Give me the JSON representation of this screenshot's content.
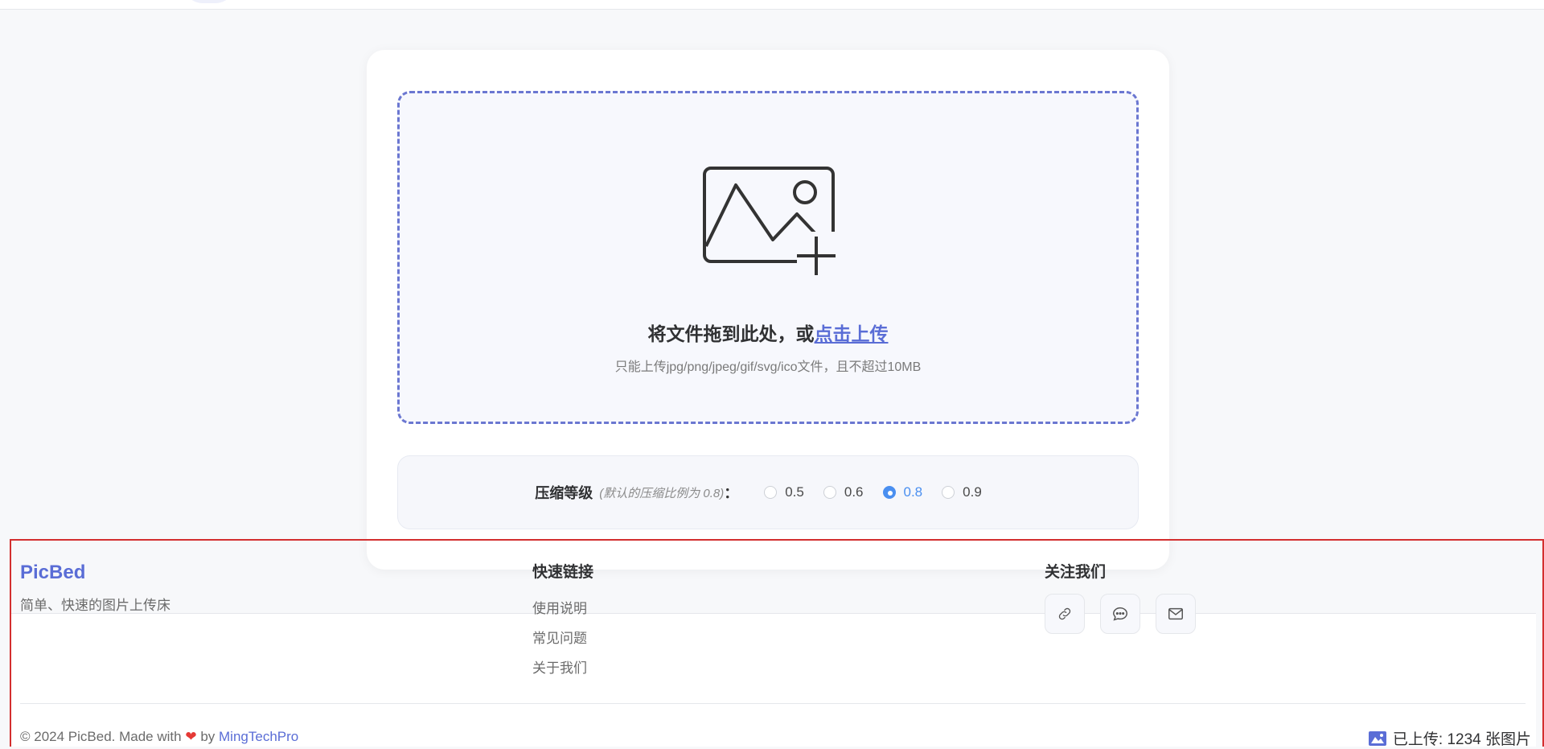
{
  "upload": {
    "title_prefix": "将文件拖到此处，或",
    "title_link": "点击上传",
    "tip": "只能上传jpg/png/jpeg/gif/svg/ico文件，且不超过10MB"
  },
  "compression": {
    "label": "压缩等级",
    "hint": "(默认的压缩比例为 0.8)",
    "colon": "：",
    "options": [
      "0.5",
      "0.6",
      "0.8",
      "0.9"
    ],
    "selected": "0.8"
  },
  "footer": {
    "brand": "PicBed",
    "tagline": "简单、快速的图片上传床",
    "quick_links_title": "快速链接",
    "quick_links": [
      "使用说明",
      "常见问题",
      "关于我们"
    ],
    "follow_title": "关注我们",
    "social_icons": [
      "link-icon",
      "chat-icon",
      "mail-icon"
    ],
    "copyright_prefix": "© 2024 PicBed. Made with",
    "heart": "❤",
    "copyright_by": "by",
    "author": "MingTechPro",
    "stats_text": "已上传: 1234 张图片"
  },
  "colors": {
    "accent": "#5a6dd6",
    "radio_selected": "#4a8ff0",
    "footer_border": "#d32f2f"
  }
}
